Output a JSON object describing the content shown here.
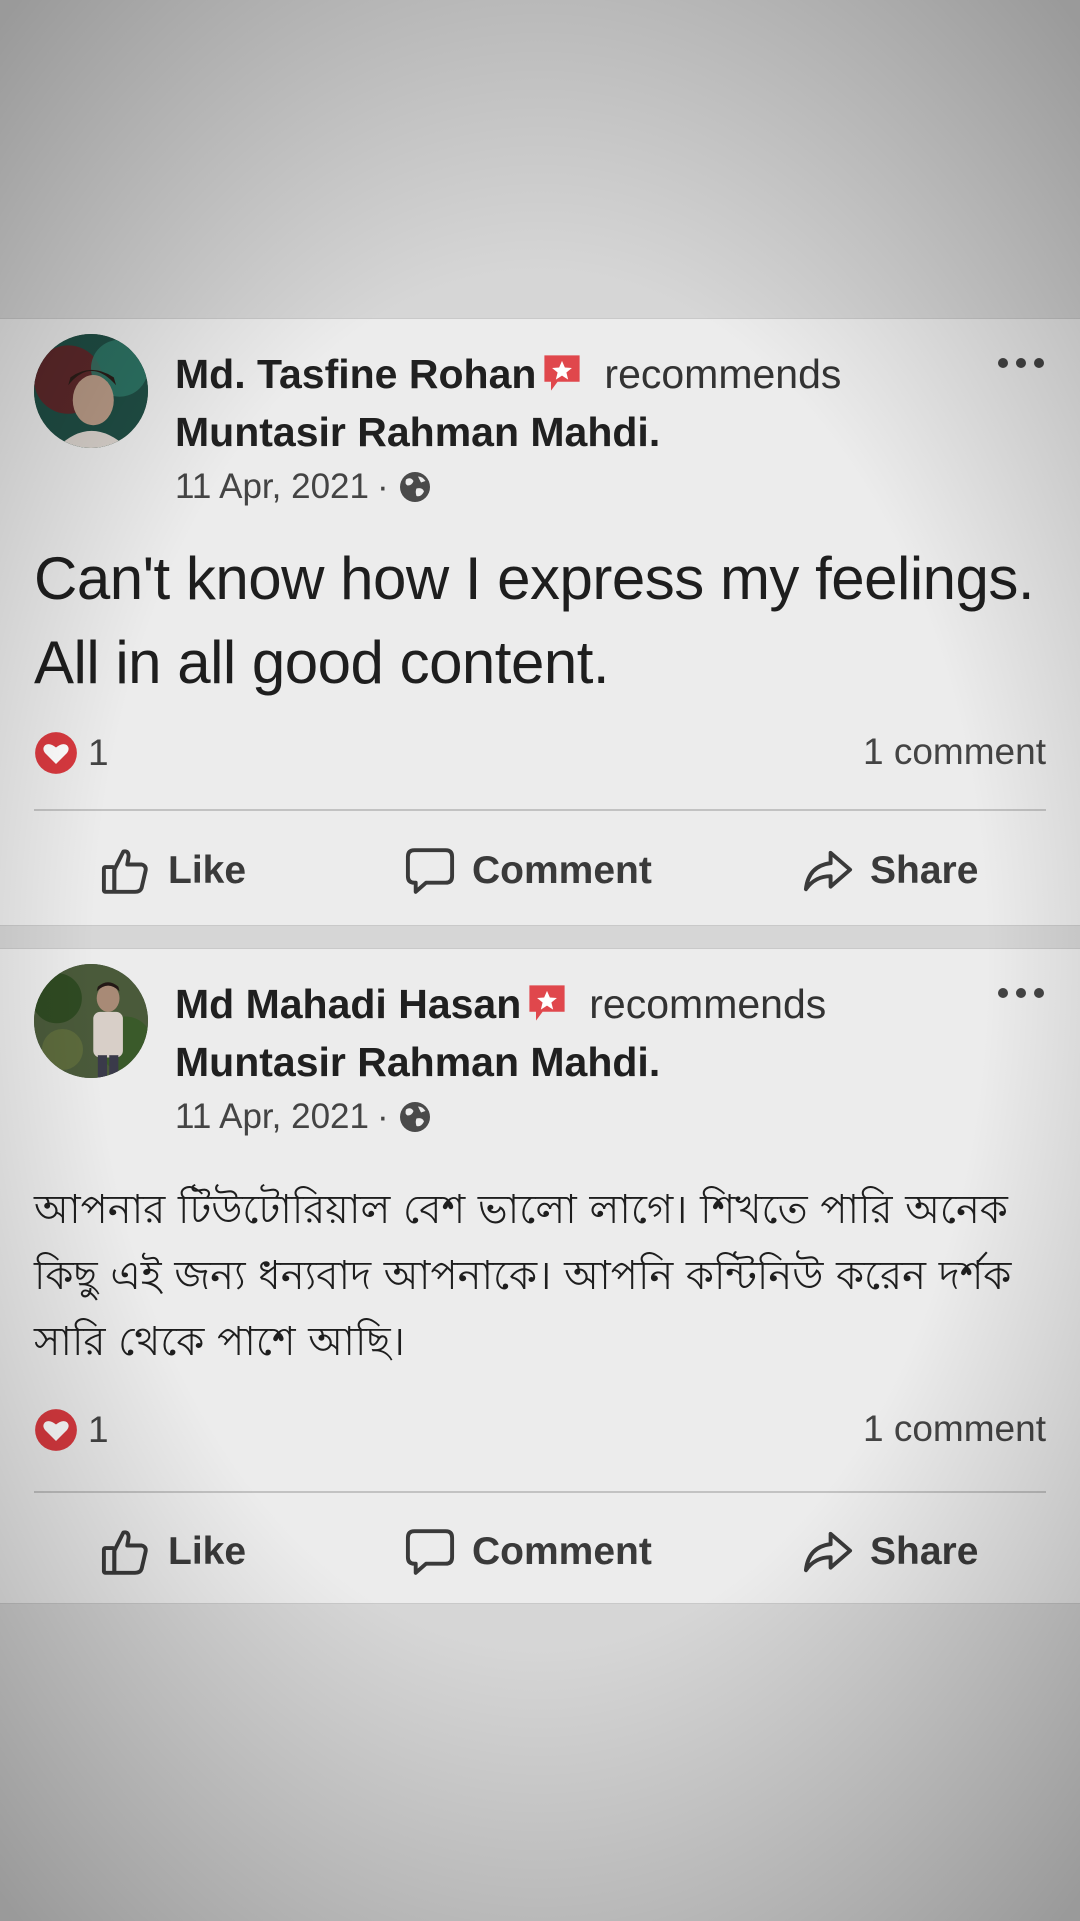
{
  "posts": [
    {
      "author": "Md. Tasfine Rohan",
      "action_text": "recommends",
      "page_name": "Muntasir Rahman Mahdi.",
      "date": "11 Apr, 2021",
      "separator": "·",
      "privacy_icon": "globe-icon",
      "body": "Can't know how I express my feelings. All in all good content.",
      "reaction_icon": "love-reaction-icon",
      "reaction_count": "1",
      "comment_count": "1 comment",
      "actions": {
        "like": "Like",
        "comment": "Comment",
        "share": "Share"
      }
    },
    {
      "author": "Md Mahadi Hasan",
      "action_text": "recommends",
      "page_name": "Muntasir Rahman Mahdi.",
      "date": "11 Apr, 2021",
      "separator": "·",
      "privacy_icon": "globe-icon",
      "body": "আপনার টিউটোরিয়াল বেশ ভালো লাগে। শিখতে পারি অনেক কিছু এই জন্য ধন্যবাদ আপনাকে। আপনি কন্টিনিউ করেন দর্শক সারি থেকে পাশে আছি।",
      "reaction_icon": "love-reaction-icon",
      "reaction_count": "1",
      "comment_count": "1 comment",
      "actions": {
        "like": "Like",
        "comment": "Comment",
        "share": "Share"
      }
    }
  ],
  "colors": {
    "card_background": "#ececec",
    "page_background": "#d6d6d6",
    "recommend_badge": "#e0474c",
    "love_reaction": "#d8393f"
  }
}
